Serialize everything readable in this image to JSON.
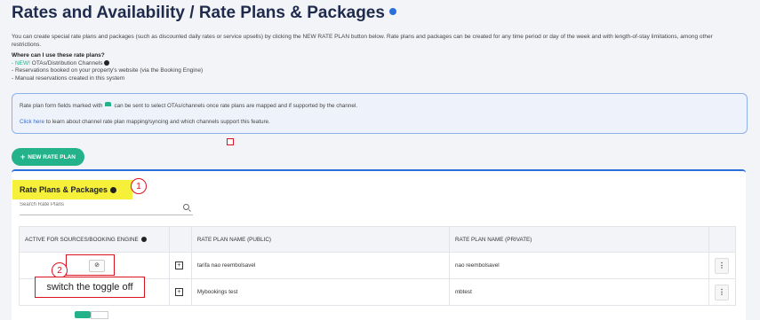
{
  "header": {
    "title": "Rates and Availability / Rate Plans & Packages"
  },
  "intro": {
    "text": "You can create special rate plans and packages (such as discounted daily rates or service upsells) by clicking the NEW RATE PLAN button below. Rate plans and packages can be created for any time period or day of the week and with length-of-stay limitations, among other restrictions."
  },
  "where": {
    "heading": "Where can I use these rate plans?",
    "new_tag": "- NEW!",
    "item1": " OTAs/Distribution Channels",
    "item2": "- Reservations booked on your property's website (via the Booking Engine)",
    "item3": "- Manual reservations created in this system"
  },
  "notice": {
    "line1_a": "Rate plan form fields marked with",
    "line1_b": "can be sent to select OTAs/channels once rate plans are mapped and if supported by the channel.",
    "link": "Click here",
    "line2": " to learn about channel rate plan mapping/syncing and which channels support this feature."
  },
  "toolbar": {
    "new_rate_plan": "NEW RATE PLAN"
  },
  "panel": {
    "title": "Rate Plans & Packages",
    "search_placeholder": "Search Rate Plans"
  },
  "table": {
    "headers": [
      "ACTIVE FOR SOURCES/BOOKING ENGINE",
      "",
      "RATE PLAN NAME (PUBLIC)",
      "RATE PLAN NAME (PRIVATE)",
      ""
    ],
    "rows": [
      {
        "public": "tarifa nao reembolsavel",
        "private": "nao reembolsavel"
      },
      {
        "public": "Mybookings test",
        "private": "mbtest"
      }
    ]
  },
  "annotations": {
    "step1": "1",
    "step2": "2",
    "caption": "switch the toggle off"
  },
  "colors": {
    "accent": "#2a6fdb",
    "green": "#23b28a",
    "highlight": "#f6f03a",
    "annotation_red": "#dd1122"
  }
}
